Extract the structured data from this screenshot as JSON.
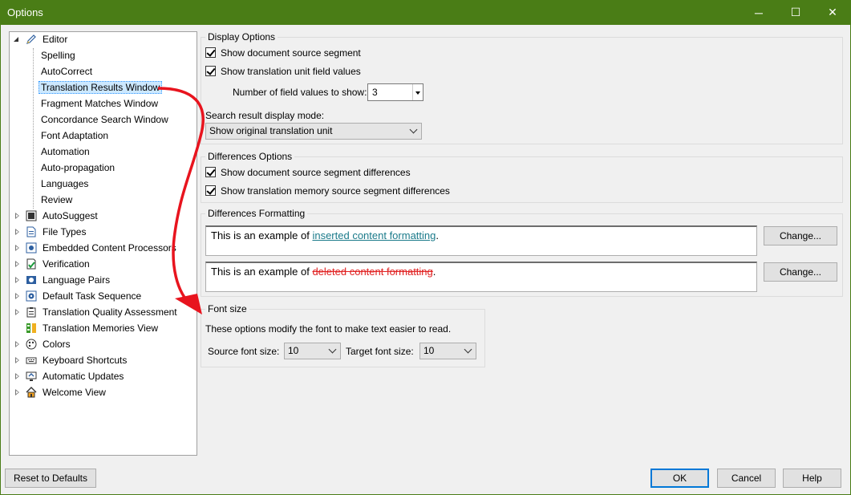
{
  "window": {
    "title": "Options",
    "minimize_glyph": "─",
    "maximize_glyph": "☐",
    "close_glyph": "✕"
  },
  "tree": {
    "editor": {
      "label": "Editor",
      "children": [
        "Spelling",
        "AutoCorrect",
        "Translation Results Window",
        "Fragment Matches Window",
        "Concordance Search Window",
        "Font Adaptation",
        "Automation",
        "Auto-propagation",
        "Languages",
        "Review"
      ]
    },
    "items": [
      "AutoSuggest",
      "File Types",
      "Embedded Content Processors",
      "Verification",
      "Language Pairs",
      "Default Task Sequence",
      "Translation Quality Assessment",
      "Translation Memories View",
      "Colors",
      "Keyboard Shortcuts",
      "Automatic Updates",
      "Welcome View"
    ]
  },
  "display_options": {
    "title": "Display Options",
    "show_source_segment": "Show document source segment",
    "show_field_values": "Show translation unit field values",
    "field_values_label": "Number of field values to show:",
    "field_values_count": "3",
    "search_mode_label": "Search result display mode:",
    "search_mode_value": "Show original translation unit"
  },
  "differences_options": {
    "title": "Differences Options",
    "doc_source_diff": "Show document source segment differences",
    "tm_source_diff": "Show translation memory source segment differences"
  },
  "differences_formatting": {
    "title": "Differences Formatting",
    "inserted_prefix": "This is an example of ",
    "inserted_text": "inserted content formatting",
    "deleted_prefix": "This is an example of ",
    "deleted_text": "deleted content formatting",
    "suffix": ".",
    "change_label": "Change..."
  },
  "font_size": {
    "title": "Font size",
    "description": "These options modify the font to make text easier to read.",
    "source_label": "Source font size:",
    "source_value": "10",
    "target_label": "Target font size:",
    "target_value": "10"
  },
  "footer": {
    "reset_label": "Reset to Defaults",
    "ok_label": "OK",
    "cancel_label": "Cancel",
    "help_label": "Help"
  },
  "colors": {
    "titlebar": "#4a7d16",
    "annotation_arrow": "#e8141e",
    "inserted": "#1a7a8a",
    "deleted": "#e01e1e"
  }
}
